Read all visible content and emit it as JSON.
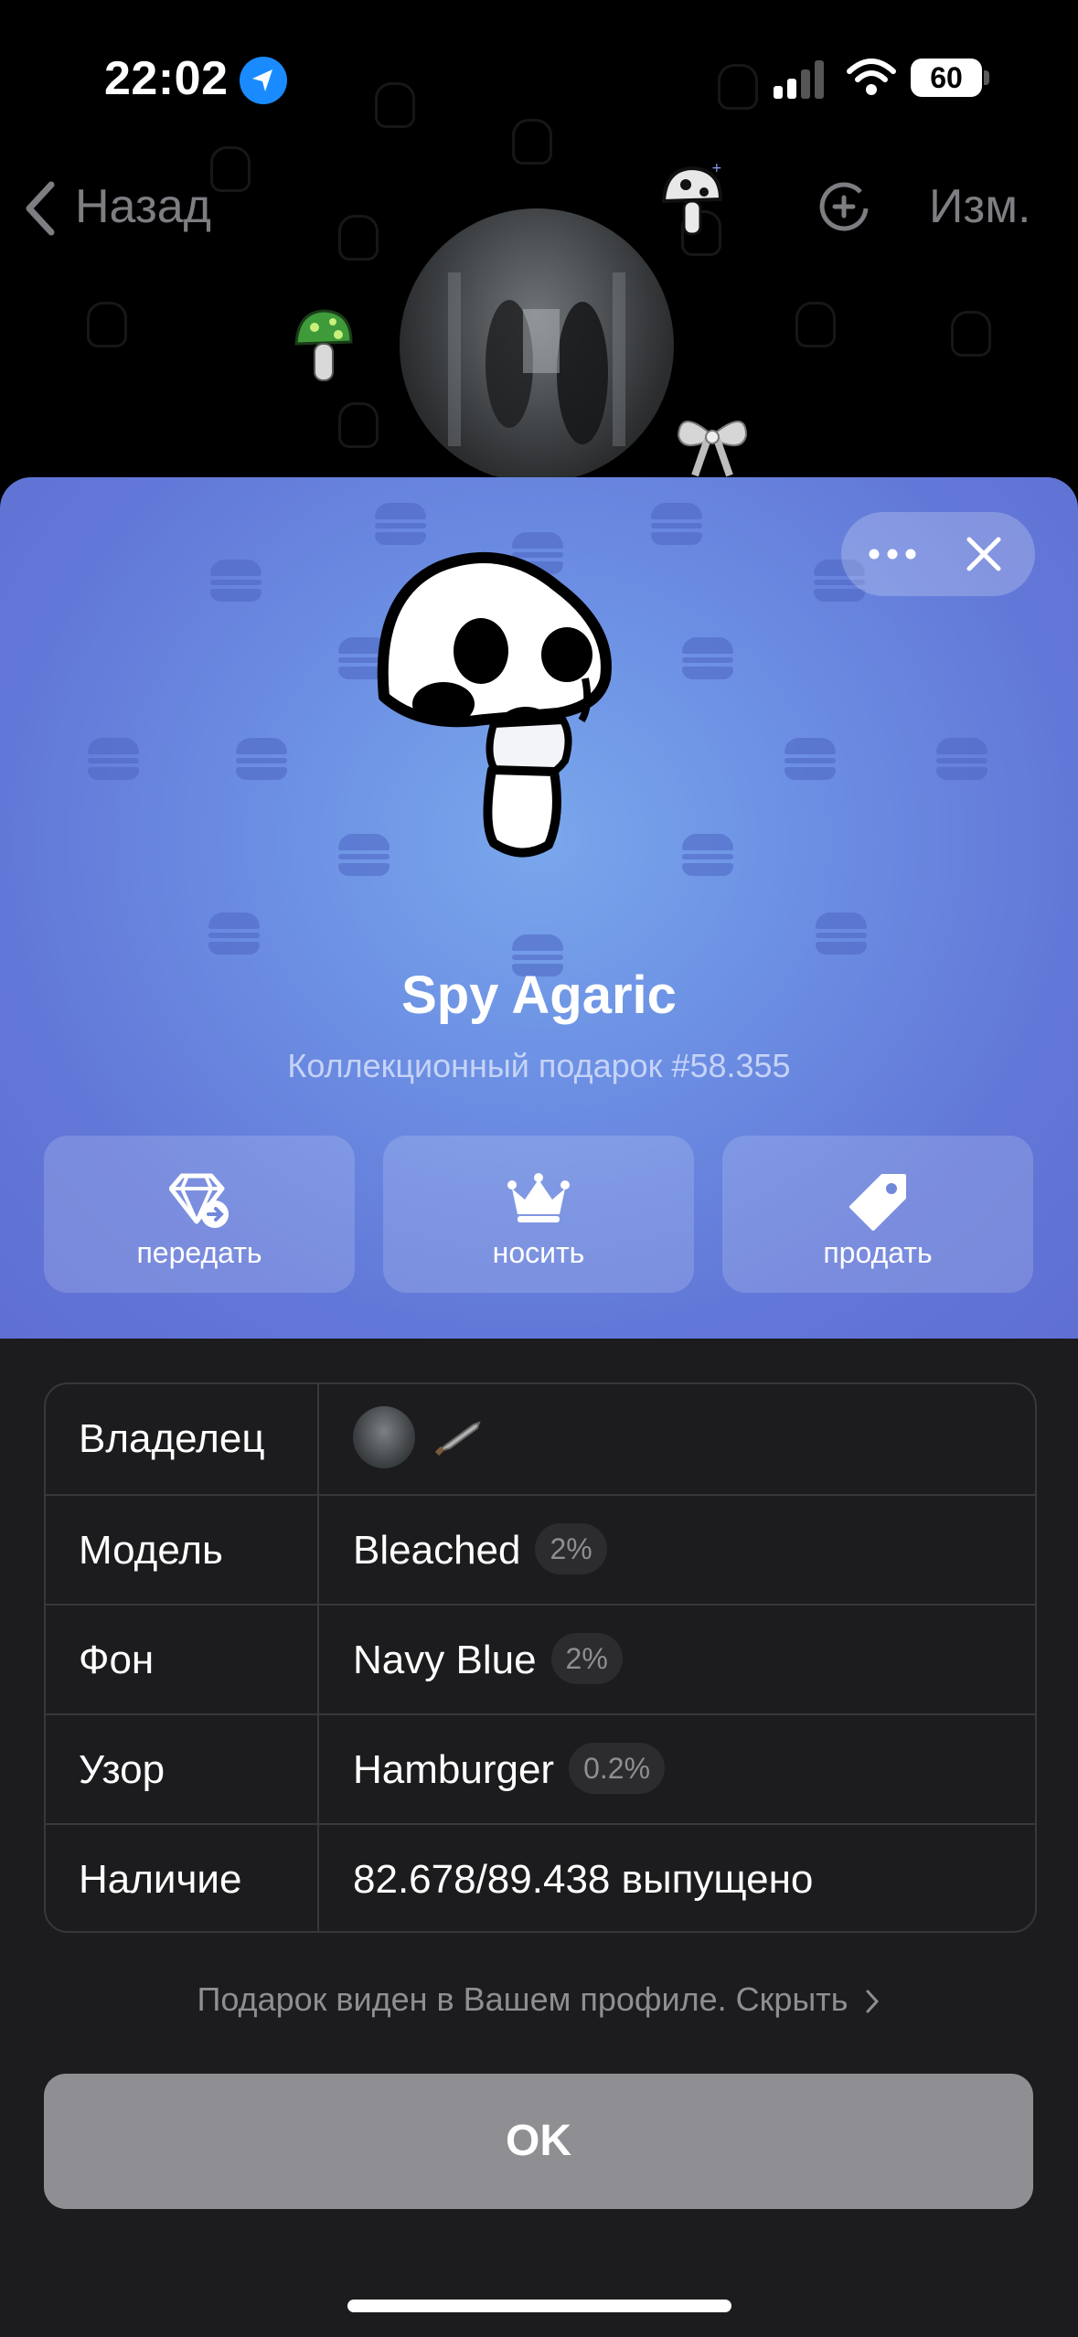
{
  "status_bar": {
    "time": "22:02",
    "battery": "60"
  },
  "nav": {
    "back_label": "Назад",
    "edit_label": "Изм."
  },
  "gift": {
    "name": "Spy Agaric",
    "subtitle": "Коллекционный подарок #58.355",
    "actions": [
      {
        "label": "передать",
        "icon": "gem-transfer-icon"
      },
      {
        "label": "носить",
        "icon": "crown-icon"
      },
      {
        "label": "продать",
        "icon": "tag-icon"
      }
    ]
  },
  "details": {
    "owner_label": "Владелец",
    "rows": [
      {
        "key": "Модель",
        "value": "Bleached",
        "badge": "2%"
      },
      {
        "key": "Фон",
        "value": "Navy Blue",
        "badge": "2%"
      },
      {
        "key": "Узор",
        "value": "Hamburger",
        "badge": "0.2%"
      },
      {
        "key": "Наличие",
        "value": "82.678/89.438 выпущено"
      }
    ]
  },
  "footer": {
    "visibility_note": "Подарок виден в Вашем профиле. Скрыть",
    "ok_label": "OK"
  },
  "colors": {
    "sheet_blue": "#6278d8",
    "pattern": "#4d66c2",
    "dark_bg": "#1c1c1e",
    "ok_button": "#8e8e93",
    "location_blue": "#1a8bff"
  }
}
